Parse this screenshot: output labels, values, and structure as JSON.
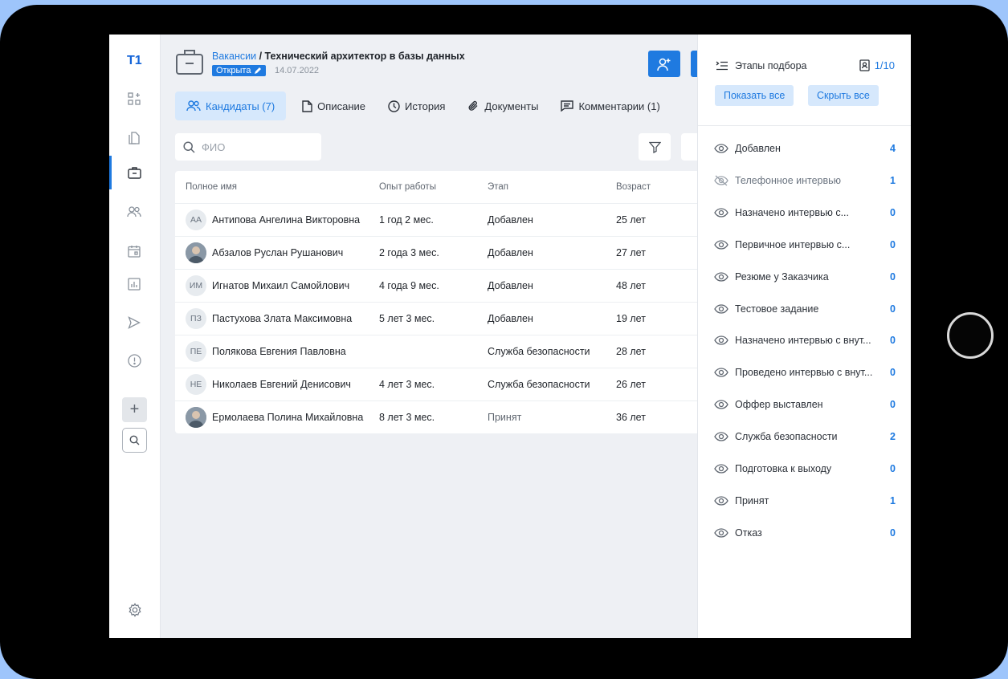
{
  "app": {
    "logo": "T1"
  },
  "header": {
    "breadcrumb_link": "Вакансии",
    "breadcrumb_separator": " / ",
    "title": "Технический архитектор в базы данных",
    "status": "Открыта",
    "date": "14.07.2022"
  },
  "tabs": [
    {
      "label": "Кандидаты (7)",
      "icon": "users-icon",
      "active": true
    },
    {
      "label": "Описание",
      "icon": "document-icon"
    },
    {
      "label": "История",
      "icon": "clock-icon"
    },
    {
      "label": "Документы",
      "icon": "paperclip-icon"
    },
    {
      "label": "Комментарии (1)",
      "icon": "comment-icon"
    }
  ],
  "search": {
    "placeholder": "ФИО",
    "value": ""
  },
  "table": {
    "columns": [
      "Полное имя",
      "Опыт работы",
      "Этап",
      "Возраст"
    ],
    "rows": [
      {
        "initials": "АА",
        "photo": false,
        "name": "Антипова Ангелина Викторовна",
        "experience": "1 год 2 мес.",
        "stage": "Добавлен",
        "age": "25 лет"
      },
      {
        "initials": "",
        "photo": true,
        "name": "Абзалов Руслан Рушанович",
        "experience": "2 года 3 мес.",
        "stage": "Добавлен",
        "age": "27 лет"
      },
      {
        "initials": "ИМ",
        "photo": false,
        "name": "Игнатов Михаил Самойлович",
        "experience": "4 года 9 мес.",
        "stage": "Добавлен",
        "age": "48 лет"
      },
      {
        "initials": "ПЗ",
        "photo": false,
        "name": "Пастухова Злата Максимовна",
        "experience": "5 лет 3 мес.",
        "stage": "Добавлен",
        "age": "19 лет"
      },
      {
        "initials": "ПЕ",
        "photo": false,
        "name": "Полякова Евгения Павловна",
        "experience": "",
        "stage": "Служба безопасности",
        "age": "28 лет"
      },
      {
        "initials": "НЕ",
        "photo": false,
        "name": "Николаев Евгений Денисович",
        "experience": "4 лет 3 мес.",
        "stage": "Служба безопасности",
        "age": "26 лет"
      },
      {
        "initials": "",
        "photo": true,
        "name": "Ермолаева Полина Михайловна",
        "experience": "8 лет 3 мес.",
        "stage": "Принят",
        "age": "36 лет"
      }
    ]
  },
  "panel": {
    "title": "Этапы подбора",
    "counter": "1/10",
    "show_all": "Показать все",
    "hide_all": "Скрыть все",
    "stages": [
      {
        "name": "Добавлен",
        "count": "4",
        "visible": true
      },
      {
        "name": "Телефонное интервью",
        "count": "1",
        "visible": false
      },
      {
        "name": "Назначено интервью с...",
        "count": "0",
        "visible": true
      },
      {
        "name": "Первичное интервью с...",
        "count": "0",
        "visible": true
      },
      {
        "name": "Резюме у Заказчика",
        "count": "0",
        "visible": true
      },
      {
        "name": "Тестовое задание",
        "count": "0",
        "visible": true
      },
      {
        "name": "Назначено интервью с внут...",
        "count": "0",
        "visible": true
      },
      {
        "name": "Проведено интервью с внут...",
        "count": "0",
        "visible": true
      },
      {
        "name": "Оффер выставлен",
        "count": "0",
        "visible": true
      },
      {
        "name": "Служба безопасности",
        "count": "2",
        "visible": true
      },
      {
        "name": "Подготовка к выходу",
        "count": "0",
        "visible": true
      },
      {
        "name": "Принят",
        "count": "1",
        "visible": true
      },
      {
        "name": "Отказ",
        "count": "0",
        "visible": true
      }
    ]
  },
  "colors": {
    "accent": "#1f7ae0",
    "background": "#9ec5fb",
    "tab_active_bg": "#d6e8fc"
  }
}
